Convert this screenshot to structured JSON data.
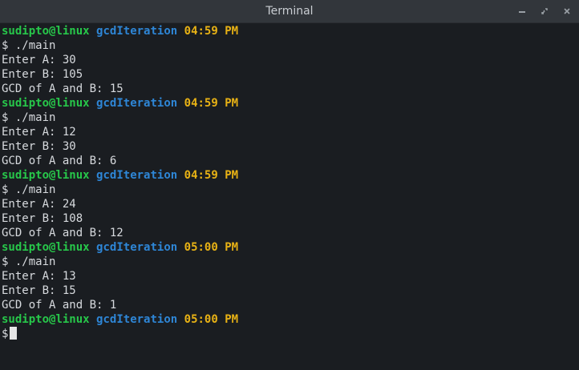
{
  "window": {
    "title": "Terminal",
    "controls": [
      "minimize-icon",
      "maximize-icon",
      "close-icon"
    ]
  },
  "colors": {
    "background": "#1a1d21",
    "titlebar": "#32363b",
    "user_host": "#27c74a",
    "directory": "#2e86d6",
    "time": "#e8b215",
    "text": "#d7dade"
  },
  "terminal": {
    "prompt_user": "sudipto",
    "prompt_at": "@",
    "prompt_host": "linux",
    "prompt_dir": "gcdIteration",
    "sessions": [
      {
        "time": "04:59 PM",
        "command": "$ ./main",
        "output": [
          "Enter A: 30",
          "Enter B: 105",
          "GCD of A and B: 15"
        ]
      },
      {
        "time": "04:59 PM",
        "command": "$ ./main",
        "output": [
          "Enter A: 12",
          "Enter B: 30",
          "GCD of A and B: 6"
        ]
      },
      {
        "time": "04:59 PM",
        "command": "$ ./main",
        "output": [
          "Enter A: 24",
          "Enter B: 108",
          "GCD of A and B: 12"
        ]
      },
      {
        "time": "05:00 PM",
        "command": "$ ./main",
        "output": [
          "Enter A: 13",
          "Enter B: 15",
          "GCD of A and B: 1"
        ]
      }
    ],
    "final_prompt_time": "05:00 PM",
    "final_prompt_symbol": "$"
  }
}
